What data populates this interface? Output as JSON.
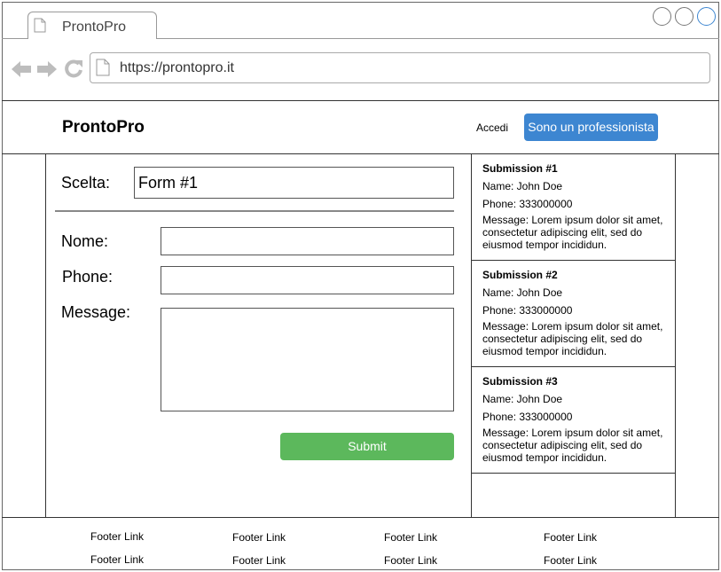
{
  "browser": {
    "tab_title": "ProntoPro",
    "url": "https://prontopro.it"
  },
  "header": {
    "brand": "ProntoPro",
    "login_label": "Accedi",
    "pro_button_label": "Sono un professionista"
  },
  "form": {
    "choice_label": "Scelta:",
    "choice_value": "Form #1",
    "name_label": "Nome:",
    "phone_label": "Phone:",
    "message_label": "Message:",
    "submit_label": "Submit"
  },
  "submissions": [
    {
      "title": "Submission #1",
      "name": "Name: John Doe",
      "phone": "Phone: 333000000",
      "message": "Message: Lorem ipsum dolor sit amet, consectetur adipiscing elit, sed do eiusmod tempor incididun."
    },
    {
      "title": "Submission #2",
      "name": "Name: John Doe",
      "phone": "Phone: 333000000",
      "message": "Message: Lorem ipsum dolor sit amet, consectetur adipiscing elit, sed do eiusmod tempor incididun."
    },
    {
      "title": "Submission #3",
      "name": "Name: John Doe",
      "phone": "Phone: 333000000",
      "message": "Message: Lorem ipsum dolor sit amet, consectetur adipiscing elit, sed do eiusmod tempor incididun."
    }
  ],
  "footer": {
    "links": [
      "Footer Link",
      "Footer Link",
      "Footer Link",
      "Footer Link",
      "Footer Link",
      "Footer Link",
      "Footer Link",
      "Footer Link"
    ]
  },
  "colors": {
    "accent_blue": "#3d86d1",
    "submit_green": "#5cb85c"
  },
  "icons": [
    "page-icon",
    "back-arrow-icon",
    "forward-arrow-icon",
    "reload-icon"
  ]
}
